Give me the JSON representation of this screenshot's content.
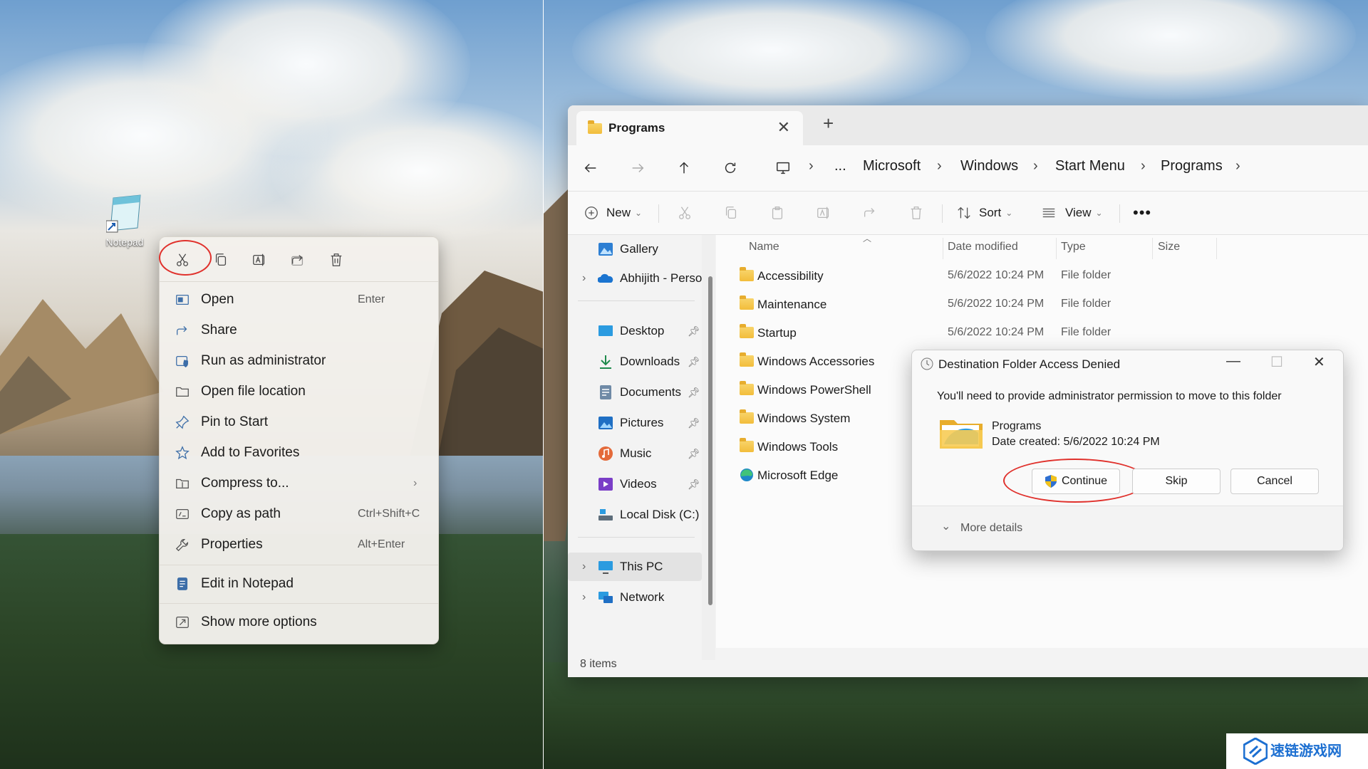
{
  "desktop": {
    "icon_label": "Notepad"
  },
  "context_menu": {
    "toolbar": [
      {
        "name": "cut",
        "icon": "scissors-icon"
      },
      {
        "name": "copy",
        "icon": "copy-icon"
      },
      {
        "name": "rename",
        "icon": "rename-icon"
      },
      {
        "name": "share",
        "icon": "share-icon"
      },
      {
        "name": "delete",
        "icon": "trash-icon"
      }
    ],
    "items": [
      {
        "label": "Open",
        "shortcut": "Enter",
        "icon": "open-icon"
      },
      {
        "label": "Share",
        "shortcut": "",
        "icon": "share-icon"
      },
      {
        "label": "Run as administrator",
        "shortcut": "",
        "icon": "shield-icon"
      },
      {
        "label": "Open file location",
        "shortcut": "",
        "icon": "folder-icon"
      },
      {
        "label": "Pin to Start",
        "shortcut": "",
        "icon": "pin-icon"
      },
      {
        "label": "Add to Favorites",
        "shortcut": "",
        "icon": "star-icon"
      },
      {
        "label": "Compress to...",
        "shortcut": "",
        "icon": "zip-icon"
      },
      {
        "label": "Copy as path",
        "shortcut": "Ctrl+Shift+C",
        "icon": "path-icon"
      },
      {
        "label": "Properties",
        "shortcut": "Alt+Enter",
        "icon": "wrench-icon"
      },
      {
        "label": "Edit in Notepad",
        "shortcut": "",
        "icon": "notepad-icon"
      },
      {
        "label": "Show more options",
        "shortcut": "",
        "icon": "expand-icon"
      }
    ]
  },
  "explorer": {
    "tab_title": "Programs",
    "breadcrumb": [
      "...",
      "Microsoft",
      "Windows",
      "Start Menu",
      "Programs"
    ],
    "commands": {
      "new": "New",
      "sort": "Sort",
      "view": "View"
    },
    "sidebar": [
      {
        "label": "Gallery",
        "icon": "gallery-icon",
        "pinned": false
      },
      {
        "label": "Abhijith - Persor",
        "icon": "onedrive-icon",
        "pinned": false
      },
      {
        "label": "Desktop",
        "icon": "desktop-icon",
        "pinned": true
      },
      {
        "label": "Downloads",
        "icon": "download-icon",
        "pinned": true
      },
      {
        "label": "Documents",
        "icon": "documents-icon",
        "pinned": true
      },
      {
        "label": "Pictures",
        "icon": "pictures-icon",
        "pinned": true
      },
      {
        "label": "Music",
        "icon": "music-icon",
        "pinned": true
      },
      {
        "label": "Videos",
        "icon": "videos-icon",
        "pinned": true
      },
      {
        "label": "Local Disk (C:)",
        "icon": "disk-icon",
        "pinned": false
      },
      {
        "label": "This PC",
        "icon": "pc-icon",
        "pinned": false
      },
      {
        "label": "Network",
        "icon": "network-icon",
        "pinned": false
      }
    ],
    "columns": {
      "name": "Name",
      "date": "Date modified",
      "type": "Type",
      "size": "Size"
    },
    "files": [
      {
        "name": "Accessibility",
        "date": "5/6/2022 10:24 PM",
        "type": "File folder"
      },
      {
        "name": "Maintenance",
        "date": "5/6/2022 10:24 PM",
        "type": "File folder"
      },
      {
        "name": "Startup",
        "date": "5/6/2022 10:24 PM",
        "type": "File folder"
      },
      {
        "name": "Windows Accessories",
        "date": "",
        "type": ""
      },
      {
        "name": "Windows PowerShell",
        "date": "",
        "type": ""
      },
      {
        "name": "Windows System",
        "date": "",
        "type": ""
      },
      {
        "name": "Windows Tools",
        "date": "",
        "type": ""
      },
      {
        "name": "Microsoft Edge",
        "date": "",
        "type": ""
      }
    ],
    "status": "8 items"
  },
  "dialog": {
    "title": "Destination Folder Access Denied",
    "message": "You'll need to provide administrator permission to move to this folder",
    "folder_name": "Programs",
    "folder_date": "Date created: 5/6/2022 10:24 PM",
    "continue": "Continue",
    "skip": "Skip",
    "cancel": "Cancel",
    "more_details": "More details"
  },
  "watermark": "速链游戏网",
  "colors": {
    "highlight_ring": "#e0312c",
    "accent": "#3d6ea8"
  }
}
